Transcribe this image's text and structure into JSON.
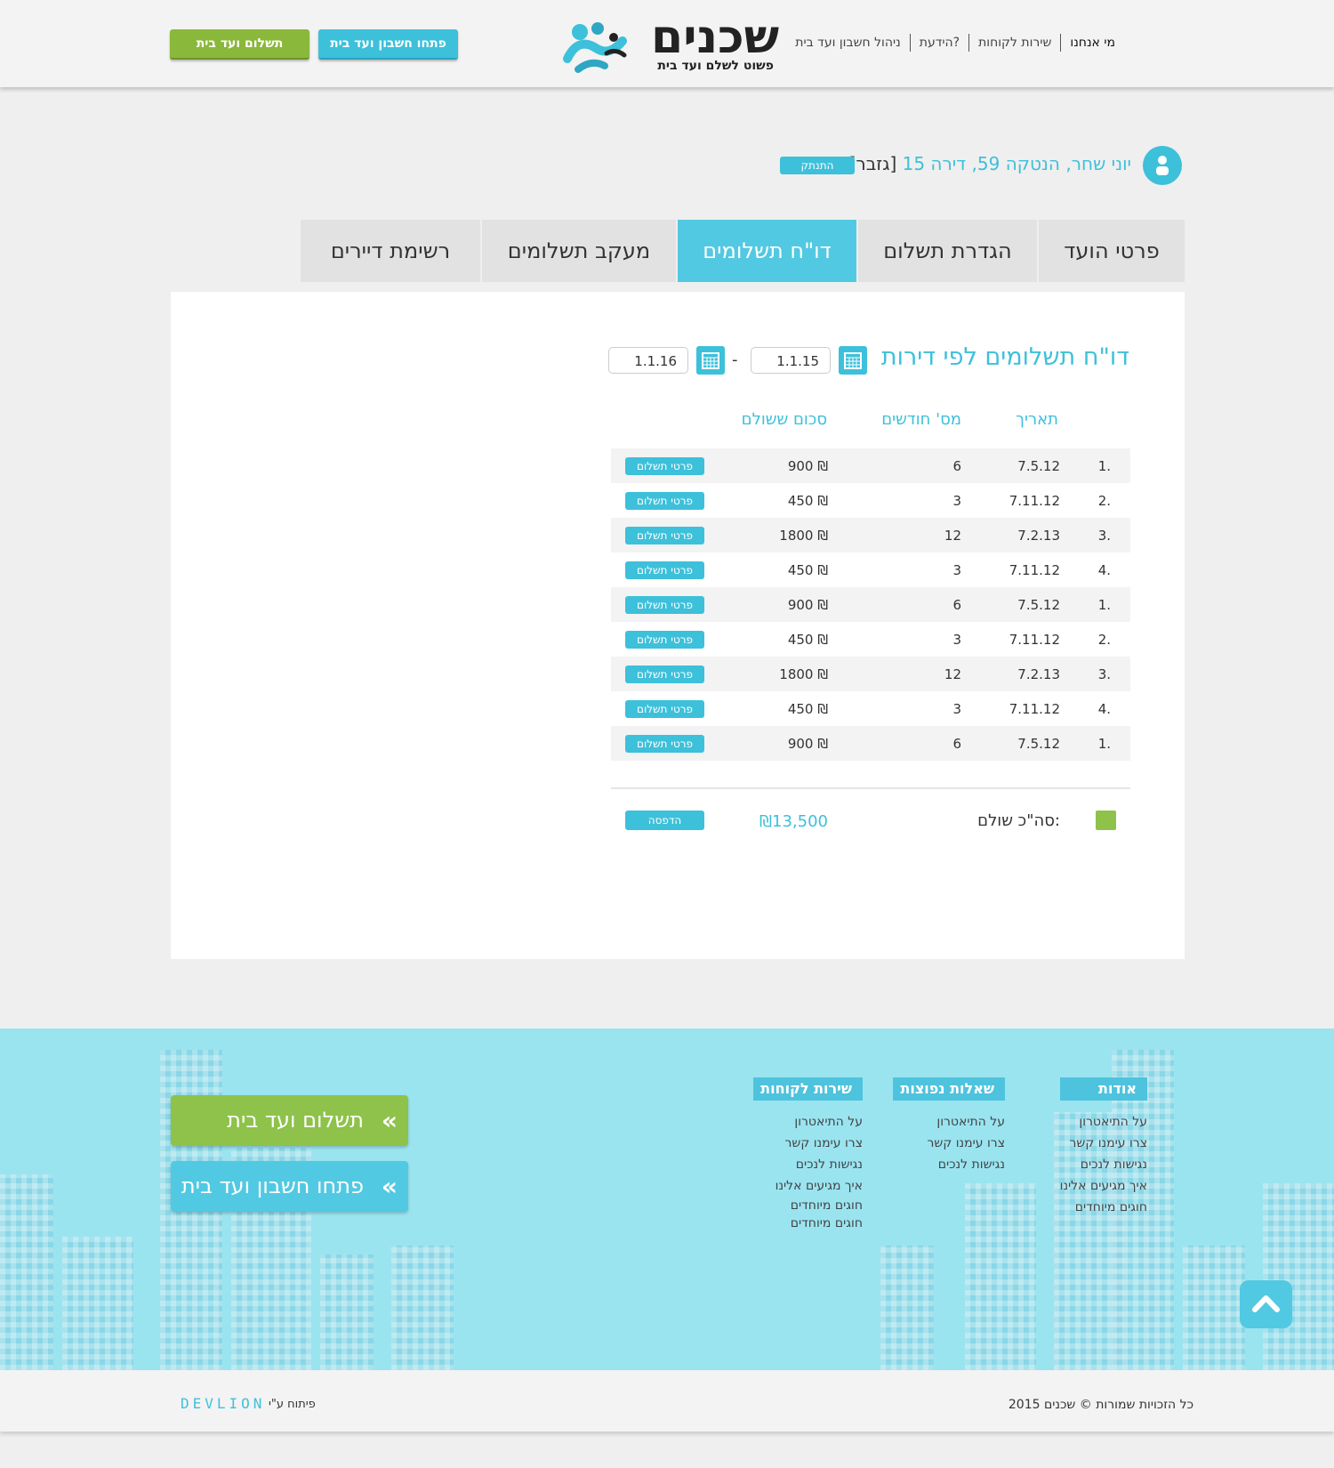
{
  "header": {
    "logo_word": "שכנים",
    "logo_tagline": "פשוט לשלם ועד בית",
    "nav": [
      "מי אנחנו",
      "שירות לקוחות",
      "הידעת?",
      "ניהול חשבון ועד בית"
    ],
    "btn_open_account": "פתחו חשבון ועד בית",
    "btn_pay": "תשלום ועד בית"
  },
  "user": {
    "name_address": "יוני שחר, הנטקה 59, דירה 15",
    "role": "[גזבר]",
    "logout": "התנתק"
  },
  "tabs": [
    "פרטי הועד",
    "הגדרת תשלום",
    "דו\"ח תשלומים",
    "מעקב תשלומים",
    "רשימת דיירים"
  ],
  "active_tab": 2,
  "report": {
    "title": "דו\"ח תשלומים לפי דירות",
    "date_from": "1.1.15",
    "date_to": "1.1.16",
    "dash": "-",
    "columns": {
      "date": "תאריך",
      "months": "מס' חודשים",
      "amount": "סכום ששולם"
    },
    "row_button": "פרטי תשלום",
    "rows": [
      {
        "num": "1.",
        "date": "7.5.12",
        "months": "6",
        "amount": "900 ₪"
      },
      {
        "num": "2.",
        "date": "7.11.12",
        "months": "3",
        "amount": "450 ₪"
      },
      {
        "num": "3.",
        "date": "7.2.13",
        "months": "12",
        "amount": "1800 ₪"
      },
      {
        "num": "4.",
        "date": "7.11.12",
        "months": "3",
        "amount": "450 ₪"
      },
      {
        "num": "1.",
        "date": "7.5.12",
        "months": "6",
        "amount": "900 ₪"
      },
      {
        "num": "2.",
        "date": "7.11.12",
        "months": "3",
        "amount": "450 ₪"
      },
      {
        "num": "3.",
        "date": "7.2.13",
        "months": "12",
        "amount": "1800 ₪"
      },
      {
        "num": "4.",
        "date": "7.11.12",
        "months": "3",
        "amount": "450 ₪"
      },
      {
        "num": "1.",
        "date": "7.5.12",
        "months": "6",
        "amount": "900 ₪"
      }
    ],
    "total_label": "סה\"כ שולם:",
    "total_value": "₪13,500",
    "print_button": "הדפסה"
  },
  "footer": {
    "col_about": {
      "title": "אודות",
      "links": [
        "על התיאטרון",
        "צרו עימנו קשר",
        "נגישות לנכים",
        "איך מגיעים אלינו",
        "חוגים מיוחדים"
      ]
    },
    "col_faq": {
      "title": "שאלות נפוצות",
      "links": [
        "על התיאטרון",
        "צרו עימנו קשר",
        "נגישות לנכים"
      ]
    },
    "col_service": {
      "title": "שירות לקוחות",
      "links": [
        "על התיאטרון",
        "צרו עימנו קשר",
        "נגישות לנכים",
        "איך מגיעים אלינו",
        "חוגים מיוחדים",
        "חוגים מיוחדים"
      ]
    },
    "big_pay": "תשלום ועד בית",
    "big_open": "פתחו חשבון ועד בית",
    "copyright": "כל הזכויות שמורות © שכנים 2015",
    "dev_label": "פיתוח ע\"י",
    "dev_name": "DEVLION"
  },
  "colors": {
    "accent": "#3dc0da",
    "green": "#8ec24a",
    "footer_bg": "#9ae4f0"
  },
  "icons": {
    "user": "user-icon",
    "calendar": "calendar-icon",
    "chevron": "double-chevron-icon",
    "to_top": "chevron-up-icon"
  }
}
